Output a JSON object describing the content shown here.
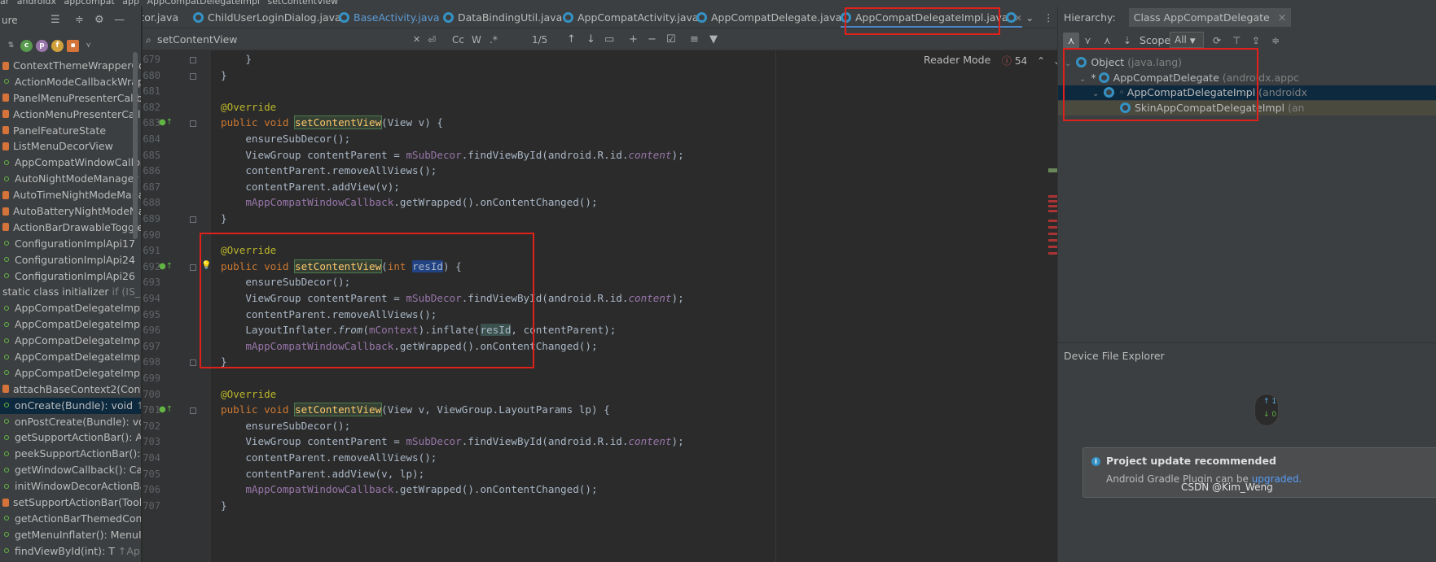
{
  "breadcrumb": [
    "ar",
    "androidx",
    "appcompat",
    "app",
    "AppCompatDelegateImpl",
    "setContentView"
  ],
  "structure": {
    "title": "ure",
    "items": [
      {
        "label": "ContextThemeWrapperCom",
        "icon": "lock"
      },
      {
        "label": "ActionModeCallbackWrapp",
        "icon": "public"
      },
      {
        "label": "PanelMenuPresenterCallba",
        "icon": "lock"
      },
      {
        "label": "ActionMenuPresenterCallba",
        "icon": "lock"
      },
      {
        "label": "PanelFeatureState",
        "icon": "lock"
      },
      {
        "label": "ListMenuDecorView",
        "icon": "lock"
      },
      {
        "label": "AppCompatWindowCallbac",
        "icon": "public"
      },
      {
        "label": "AutoNightModeManager",
        "icon": "public"
      },
      {
        "label": "AutoTimeNightModeManag",
        "icon": "lock"
      },
      {
        "label": "AutoBatteryNightModeMan",
        "icon": "lock"
      },
      {
        "label": "ActionBarDrawableToggleIn",
        "icon": "lock"
      },
      {
        "label": "ConfigurationImplApi17",
        "icon": "public"
      },
      {
        "label": "ConfigurationImplApi24",
        "icon": "public"
      },
      {
        "label": "ConfigurationImplApi26",
        "icon": "public"
      },
      {
        "label": "static class initializer",
        "extra": "if (IS_PRE",
        "icon": "none"
      },
      {
        "label": "AppCompatDelegateImpl(A",
        "icon": "public"
      },
      {
        "label": "AppCompatDelegateImpl(D",
        "icon": "public"
      },
      {
        "label": "AppCompatDelegateImpl(C",
        "icon": "public"
      },
      {
        "label": "AppCompatDelegateImpl(C",
        "icon": "public"
      },
      {
        "label": "AppCompatDelegateImpl(C",
        "icon": "public"
      },
      {
        "label": "attachBaseContext2(Context",
        "icon": "lock"
      },
      {
        "label": "onCreate(Bundle): void",
        "extra": "↑Ap",
        "icon": "public",
        "selected": true
      },
      {
        "label": "onPostCreate(Bundle): void",
        "icon": "public"
      },
      {
        "label": "getSupportActionBar(): Actio",
        "icon": "public"
      },
      {
        "label": "peekSupportActionBar(): Ac",
        "icon": "public"
      },
      {
        "label": "getWindowCallback(): Callb",
        "icon": "public"
      },
      {
        "label": "initWindowDecorActionBar(",
        "icon": "public"
      },
      {
        "label": "setSupportActionBar(Toolba",
        "icon": "lock"
      },
      {
        "label": "getActionBarThemedContex",
        "icon": "public"
      },
      {
        "label": "getMenuInflater(): MenuInfl",
        "icon": "public"
      },
      {
        "label": "findViewById(int): T",
        "extra": "↑AppCo",
        "icon": "public"
      }
    ]
  },
  "tabs": [
    {
      "label": "nitor.java",
      "icon": false
    },
    {
      "label": "ChildUserLoginDialog.java",
      "icon": true
    },
    {
      "label": "BaseActivity.java",
      "icon": true
    },
    {
      "label": "DataBindingUtil.java",
      "icon": true
    },
    {
      "label": "AppCompatActivity.java",
      "icon": true
    },
    {
      "label": "AppCompatDelegate.java",
      "icon": true
    },
    {
      "label": "AppCompatDelegateImpl.java",
      "icon": true,
      "active": true
    }
  ],
  "find": {
    "query": "setContentView",
    "count": "1/5",
    "cc": "Cc",
    "w": "W",
    "regex": ".*"
  },
  "editor": {
    "reader_mode": "Reader Mode",
    "warnings": "54",
    "lines": [
      {
        "n": "679",
        "html": "    }"
      },
      {
        "n": "680",
        "html": "}"
      },
      {
        "n": "681",
        "html": ""
      },
      {
        "n": "682",
        "html": "<span class='an'>@Override</span>"
      },
      {
        "n": "683",
        "html": "<span class='k'>public void </span><span class='m hl'>setContentView</span>(View v) {"
      },
      {
        "n": "684",
        "html": "    ensureSubDecor();"
      },
      {
        "n": "685",
        "html": "    ViewGroup contentParent = <span class='f'>mSubDecor</span>.findViewById(android.R.id.<span class='f it'>content</span>);"
      },
      {
        "n": "686",
        "html": "    contentParent.removeAllViews();"
      },
      {
        "n": "687",
        "html": "    contentParent.addView(v);"
      },
      {
        "n": "688",
        "html": "    <span class='f'>mAppCompatWindowCallback</span>.getWrapped().onContentChanged();"
      },
      {
        "n": "689",
        "html": "}"
      },
      {
        "n": "690",
        "html": ""
      },
      {
        "n": "691",
        "html": "<span class='an'>@Override</span>"
      },
      {
        "n": "692",
        "html": "<span class='k'>public void </span><span class='m hl'>setContentView</span>(<span class='k'>int </span><span class='hlb'>resId</span>) {"
      },
      {
        "n": "693",
        "html": "    ensureSubDecor();"
      },
      {
        "n": "694",
        "html": "    ViewGroup contentParent = <span class='f'>mSubDecor</span>.findViewById(android.R.id.<span class='f it'>content</span>);"
      },
      {
        "n": "695",
        "html": "    contentParent.removeAllViews();"
      },
      {
        "n": "696",
        "html": "    LayoutInflater.<span class='it'>from</span>(<span class='f'>mContext</span>).inflate(<span class='hlg'>resId</span>, contentParent);"
      },
      {
        "n": "697",
        "html": "    <span class='f'>mAppCompatWindowCallback</span>.getWrapped().onContentChanged();"
      },
      {
        "n": "698",
        "html": "}"
      },
      {
        "n": "699",
        "html": ""
      },
      {
        "n": "700",
        "html": "<span class='an'>@Override</span>"
      },
      {
        "n": "701",
        "html": "<span class='k'>public void </span><span class='m hl'>setContentView</span>(View v, ViewGroup.LayoutParams lp) {"
      },
      {
        "n": "702",
        "html": "    ensureSubDecor();"
      },
      {
        "n": "703",
        "html": "    ViewGroup contentParent = <span class='f'>mSubDecor</span>.findViewById(android.R.id.<span class='f it'>content</span>);"
      },
      {
        "n": "704",
        "html": "    contentParent.removeAllViews();"
      },
      {
        "n": "705",
        "html": "    contentParent.addView(v, lp);"
      },
      {
        "n": "706",
        "html": "    <span class='f'>mAppCompatWindowCallback</span>.getWrapped().onContentChanged();"
      },
      {
        "n": "707",
        "html": "}"
      }
    ]
  },
  "hierarchy": {
    "label": "Hierarchy:",
    "tab": "Class AppCompatDelegate",
    "scope_label": "Scope:",
    "scope_value": "All",
    "tree": [
      {
        "name": "Object",
        "pkg": "(java.lang)"
      },
      {
        "name": "AppCompatDelegate",
        "pkg": "(androidx.appc"
      },
      {
        "name": "AppCompatDelegateImpl",
        "pkg": "(androidx"
      },
      {
        "name": "SkinAppCompatDelegateImpl",
        "pkg": "(an"
      }
    ]
  },
  "device_file_explorer": {
    "title": "Device File Explorer"
  },
  "notification": {
    "title": "Project update recommended",
    "body": "Android Gradle Plugin can be",
    "link": "upgraded."
  },
  "network": {
    "up": "1",
    "down": "0"
  },
  "watermark": "CSDN @Kim_Weng"
}
